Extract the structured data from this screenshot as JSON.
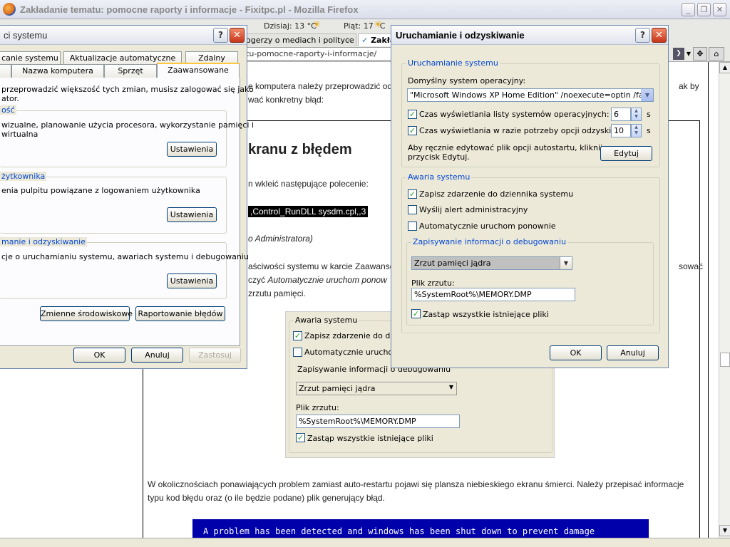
{
  "firefox": {
    "title": "Zakładanie tematu: pomocne raporty i informacje - Fixitpc.pl - Mozilla Firefox",
    "weather_today": "Dzisiaj: 13 °C",
    "weather_fri": "Piąt: 17 °C",
    "tab1": "ogerzy o mediach i polityce",
    "tab2": "Zakła",
    "url": "tu-pomocne-raporty-i-informacje/"
  },
  "article": {
    "line1a": "e komputera należy przeprowadzić od",
    "line1b": "ak by",
    "line2": "wać konkretny błąd:",
    "heading": "kranu z błędem",
    "line3": "n wkleić następujące polecenie:",
    "command": ",Control_RunDLL sysdm.cpl,,3",
    "line4": "o Administratora)",
    "line5a": "aściwości systemu w karcie Zaawansc",
    "line5b": "sować",
    "line6a": "czyć ",
    "line6b": "Automatycznie uruchom ponow",
    "line7": "zrzutu pamięci.",
    "para1": "W okolicznościach ponawiających problem zamiast auto-restartu pojawi się plansza niebieskiego ekranu śmierci. Należy przepisać informacje typu kod błędu oraz (o ile będzie podane) plik generujący błąd.",
    "bsod": "A problem has been detected and windows has been shut down to prevent damage",
    "shot": {
      "group_label": "Awaria systemu",
      "write_event": "Zapisz zdarzenie do dzienn",
      "auto_restart": "Automatycznie uruchom p",
      "debug_label": "Zapisywanie informacji o debugowaniu",
      "dump_type": "Zrzut pamięci jądra",
      "dump_file_label": "Plik zrzutu:",
      "dump_file": "%SystemRoot%\\MEMORY.DMP",
      "overwrite": "Zastąp wszystkie istniejące pliki"
    }
  },
  "sysprops": {
    "title": "ci systemu",
    "tabs_row1": [
      "canie systemu",
      "Aktualizacje automatyczne",
      "Zdalny"
    ],
    "tabs_row2": [
      "",
      "Nazwa komputera",
      "Sprzęt",
      "Zaawansowane"
    ],
    "intro": "przeprowadzić większość tych zmian, musisz zalogować się jako\nator.",
    "perf_label": "ość",
    "perf_text": "wizualne, planowanie użycia procesora, wykorzystanie pamięci i\nwirtualna",
    "profile_label": "żytkownika",
    "profile_text": "enia pulpitu powiązane z logowaniem użytkownika",
    "startup_label": "manie i odzyskiwanie",
    "startup_text": "cje o uruchamianiu systemu, awariach systemu i debugowaniu",
    "settings": "Ustawienia",
    "env_vars": "Zmienne środowiskowe",
    "error_report": "Raportowanie błędów",
    "ok": "OK",
    "cancel": "Anuluj",
    "apply": "Zastosuj"
  },
  "startup": {
    "title": "Uruchamianie i odzyskiwanie",
    "startup_group": "Uruchamianie systemu",
    "default_os_label": "Domyślny system operacyjny:",
    "default_os": "\"Microsoft Windows XP Home Edition\" /noexecute=optin /fastdetect",
    "time_list_label": "Czas wyświetlania listy systemów operacyjnych:",
    "time_list_value": "6",
    "time_recovery_label": "Czas wyświetlania w razie potrzeby opcji odzyskiwania:",
    "time_recovery_value": "10",
    "seconds": "s",
    "edit_text": "Aby ręcznie edytować plik opcji autostartu, kliknij\nprzycisk Edytuj.",
    "edit_button": "Edytuj",
    "failure_group": "Awaria systemu",
    "write_event": "Zapisz zdarzenie do dziennika systemu",
    "write_event_checked": true,
    "send_alert": "Wyślij alert administracyjny",
    "send_alert_checked": false,
    "auto_restart": "Automatycznie uruchom ponownie",
    "auto_restart_checked": false,
    "debug_group": "Zapisywanie informacji o debugowaniu",
    "dump_type": "Zrzut pamięci jądra",
    "dump_file_label": "Plik zrzutu:",
    "dump_file": "%SystemRoot%\\MEMORY.DMP",
    "overwrite": "Zastąp wszystkie istniejące pliki",
    "overwrite_checked": true,
    "ok": "OK",
    "cancel": "Anuluj"
  }
}
